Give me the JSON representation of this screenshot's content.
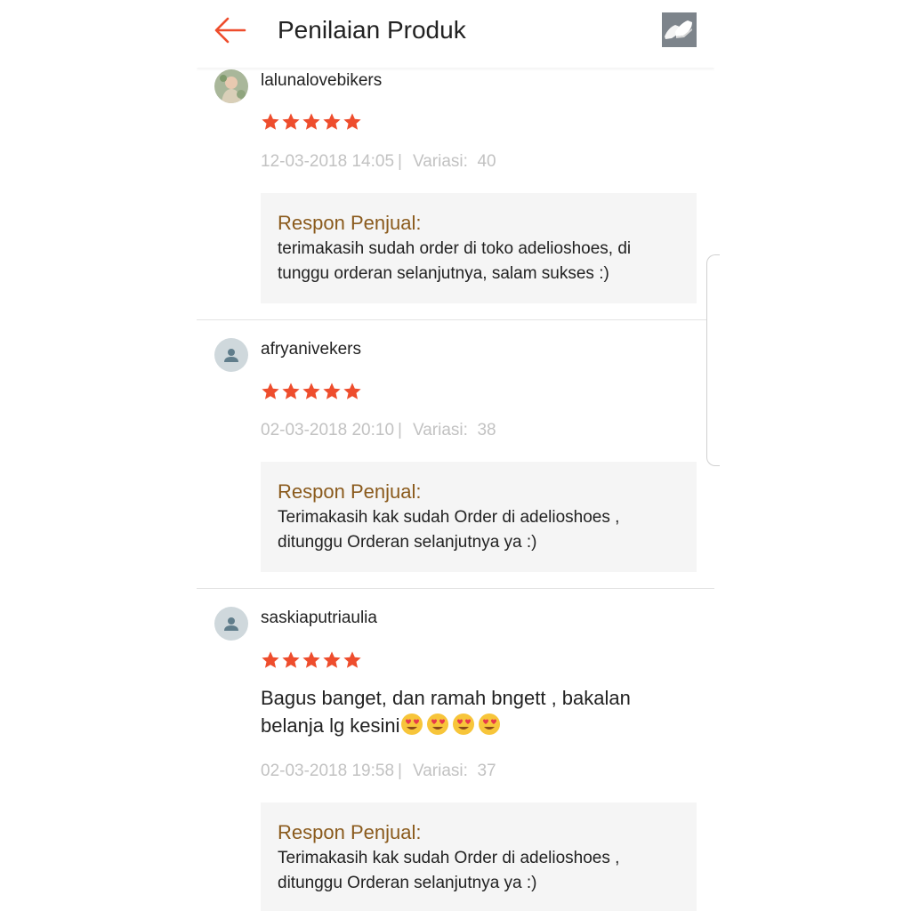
{
  "header": {
    "back_icon": "arrow-left-icon",
    "title": "Penilaian Produk",
    "product_thumbnail": "white-sneakers-image"
  },
  "colors": {
    "accent": "#ee4d2d",
    "star": "#ee4d2d",
    "reply_label": "#8a5a1c",
    "meta_text": "#c2c2c2",
    "reply_bg": "#f5f5f5"
  },
  "reviews": [
    {
      "username": "lalunalovebikers",
      "avatar": "photo-avatar",
      "rating": 5,
      "date": "12-03-2018 14:05",
      "variation_label": "Variasi:",
      "variation_value": "40",
      "text": "",
      "reply_label": "Respon Penjual:",
      "reply_text": "terimakasih sudah order di toko adelioshoes, di tunggu orderan selanjutnya, salam sukses :)"
    },
    {
      "username": "afryanivekers",
      "avatar": "person-icon",
      "rating": 5,
      "date": "02-03-2018 20:10",
      "variation_label": "Variasi:",
      "variation_value": "38",
      "text": "",
      "reply_label": "Respon Penjual:",
      "reply_text": "Terimakasih kak sudah Order di adelioshoes , ditunggu Orderan selanjutnya ya :)"
    },
    {
      "username": "saskiaputriaulia",
      "avatar": "person-icon",
      "rating": 5,
      "date": "02-03-2018 19:58",
      "variation_label": "Variasi:",
      "variation_value": "37",
      "text": "Bagus banget, dan ramah bngett , bakalan belanja lg kesini",
      "text_emojis": [
        "heart-eyes-emoji",
        "heart-eyes-emoji",
        "heart-eyes-emoji",
        "heart-eyes-emoji"
      ],
      "reply_label": "Respon Penjual:",
      "reply_text": "Terimakasih kak sudah Order di adelioshoes , ditunggu Orderan selanjutnya ya :)"
    }
  ]
}
